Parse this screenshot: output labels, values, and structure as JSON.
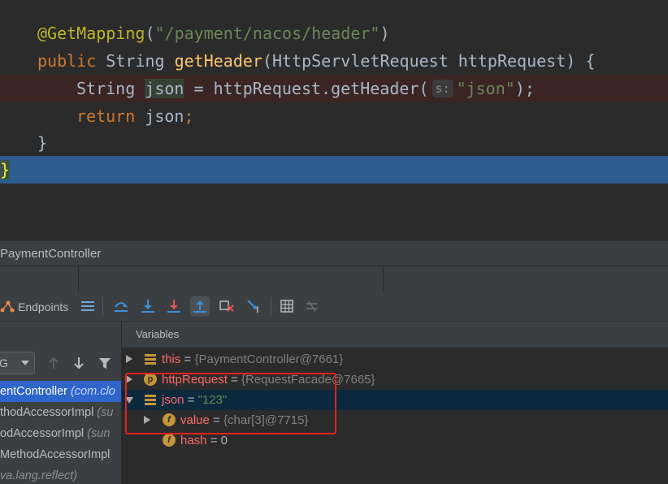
{
  "editor": {
    "lines": {
      "annotation": "@GetMapping",
      "mapping_open": "(",
      "mapping_path": "\"/payment/nacos/header\"",
      "mapping_close": ")",
      "kw_public": "public",
      "type_string": "String",
      "method_name": "getHeader",
      "params": "(HttpServletRequest httpRequest) {",
      "local_type": "String",
      "local_var": "json",
      "assign": " = httpRequest.getHeader(",
      "param_hint": "s:",
      "header_arg": "\"json\"",
      "call_close": ");",
      "kw_return": "return",
      "return_var": "json",
      "semicolon": ";",
      "inner_close": "}",
      "outer_close": "}"
    }
  },
  "debug": {
    "title": "PaymentController",
    "toolbar": {
      "endpoints_label": "Endpoints",
      "icons": [
        "show-execution-point-icon",
        "step-over-icon",
        "step-into-icon",
        "force-step-into-icon",
        "step-out-icon",
        "drop-frame-icon",
        "run-to-cursor-icon",
        "evaluate-expression-icon",
        "trace-icon"
      ]
    },
    "frames": {
      "thread_value": "G",
      "items": [
        {
          "name": "entController",
          "pkg": " (com.clo"
        },
        {
          "name": "thodAccessorImpl",
          "pkg": " (su"
        },
        {
          "name": "odAccessorImpl",
          "pkg": " (sun"
        },
        {
          "name": "MethodAccessorImpl",
          "pkg": ""
        },
        {
          "name": "",
          "pkg": "va.lang.reflect)"
        }
      ]
    },
    "variables": {
      "header": "Variables",
      "items": [
        {
          "name": "this",
          "eq": " = ",
          "value": "{PaymentController@7661}"
        },
        {
          "name": "httpRequest",
          "eq": " = ",
          "value": "{RequestFacade@7665}"
        },
        {
          "name": "json",
          "eq": " = ",
          "value": "\"123\""
        },
        {
          "name": "value",
          "eq": " = ",
          "value": "{char[3]@7715}"
        },
        {
          "name": "hash",
          "eq": " = ",
          "value": "0"
        }
      ]
    }
  },
  "colors": {
    "editor_bg": "#2b2b2b",
    "execution_line": "#2d5c8e",
    "breakpoint_line": "#3b2424",
    "highlight_box": "#e3231e"
  }
}
